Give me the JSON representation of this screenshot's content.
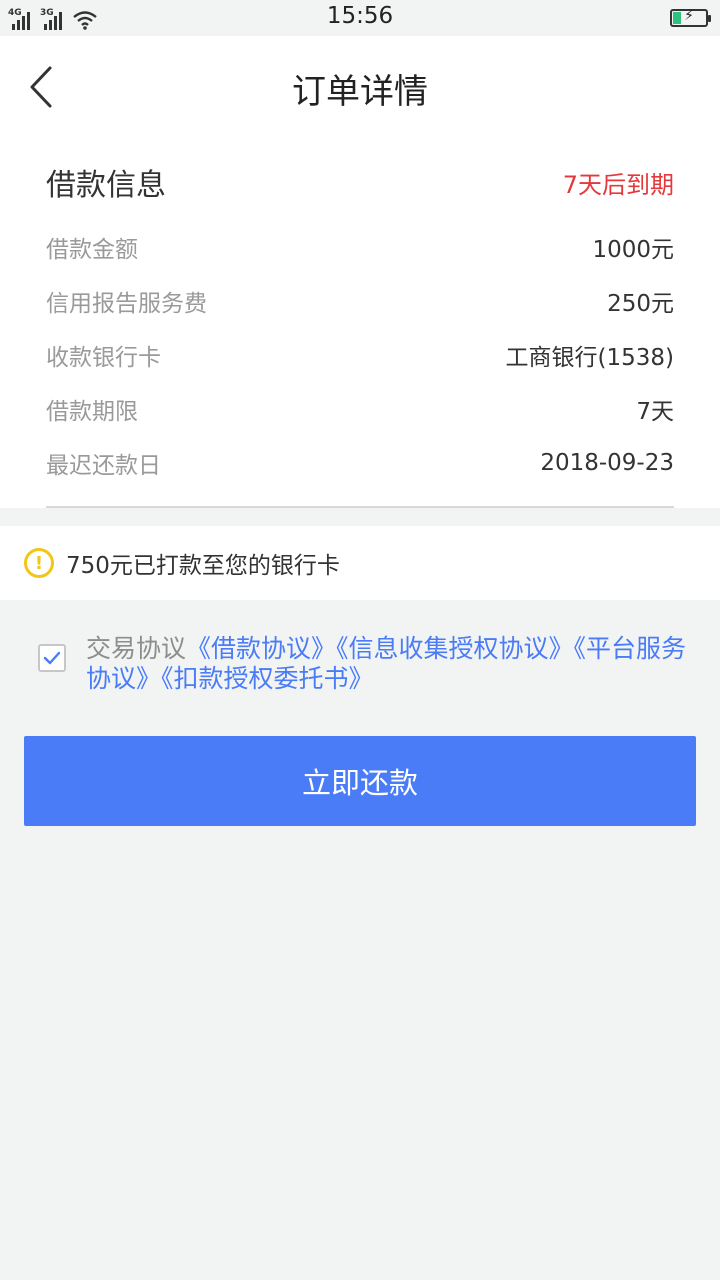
{
  "status_bar": {
    "left_labels": [
      "4G",
      "3G"
    ],
    "time": "15:56",
    "battery_level": 0.3
  },
  "header": {
    "title": "订单详情"
  },
  "loan_info": {
    "title": "借款信息",
    "due_text": "7天后到期",
    "rows": [
      {
        "label": "借款金额",
        "value": "1000元"
      },
      {
        "label": "信用报告服务费",
        "value": "250元"
      },
      {
        "label": "收款银行卡",
        "value": "工商银行(1538)"
      },
      {
        "label": "借款期限",
        "value": "7天"
      },
      {
        "label": "最迟还款日",
        "value": "2018-09-23"
      }
    ]
  },
  "notice": {
    "icon": "warning-icon",
    "text": "750元已打款至您的银行卡"
  },
  "agreement": {
    "checked": true,
    "prefix": "交易协议",
    "links": [
      "《借款协议》",
      "《信息收集授权协议》",
      "《平台服务协议》",
      "《扣款授权委托书》"
    ]
  },
  "action": {
    "repay_label": "立即还款"
  },
  "colors": {
    "accent": "#4a7cf7",
    "due_red": "#e4393c",
    "warning_yellow": "#f2c516",
    "background": "#f2f3f3"
  }
}
